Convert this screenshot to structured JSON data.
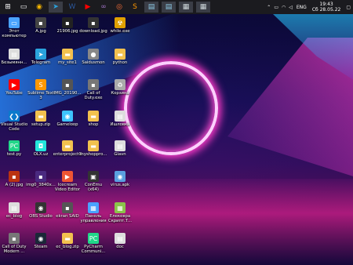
{
  "taskbar": {
    "apps": [
      {
        "name": "start-icon",
        "glyph": "⊞",
        "color": "#ffffff"
      },
      {
        "name": "task-view-icon",
        "glyph": "▭",
        "color": "#ffffff"
      },
      {
        "name": "chrome-icon",
        "glyph": "◉",
        "color": "#f4b400"
      },
      {
        "name": "telegram-icon",
        "glyph": "➤",
        "color": "#2aa3dd",
        "active": true
      },
      {
        "name": "word-icon",
        "glyph": "W",
        "color": "#2b579a"
      },
      {
        "name": "youtube-icon",
        "glyph": "▶",
        "color": "#ff0000"
      },
      {
        "name": "visual-studio-icon",
        "glyph": "∞",
        "color": "#a074c4"
      },
      {
        "name": "firefox-icon",
        "glyph": "◎",
        "color": "#ff7139"
      },
      {
        "name": "sublime-icon",
        "glyph": "S",
        "color": "#ff9800"
      },
      {
        "name": "file-explorer-icon",
        "glyph": "▤",
        "color": "#8ecae6",
        "active": true
      },
      {
        "name": "file-explorer-icon-2",
        "glyph": "▤",
        "color": "#8ecae6",
        "active": true
      },
      {
        "name": "terminal-icon",
        "glyph": "▦",
        "color": "#cfd8dc",
        "active": true
      },
      {
        "name": "terminal-icon-2",
        "glyph": "▦",
        "color": "#cfd8dc",
        "active": true
      }
    ],
    "tray": {
      "lang": "ENG",
      "time": "19:43",
      "date": "Сб 28.05.22"
    }
  },
  "icons": [
    {
      "label": "Этот компьютер",
      "glyph": "▭",
      "color": "#4aa3ff"
    },
    {
      "label": "A.jpg",
      "glyph": "▪",
      "color": "#444"
    },
    {
      "label": "21906.jpg",
      "glyph": "▪",
      "color": "#222"
    },
    {
      "label": "download.jpg",
      "glyph": "▪",
      "color": "#333"
    },
    {
      "label": "while.exe",
      "glyph": "☢",
      "color": "#e0a000"
    },
    {
      "label": "Безымянн...",
      "glyph": "▤",
      "color": "#ddd"
    },
    {
      "label": "Telegram",
      "glyph": "➤",
      "color": "#2aa3dd"
    },
    {
      "label": "my_site1",
      "glyph": "▬",
      "color": "#f2c14e"
    },
    {
      "label": "Saidusmon",
      "glyph": "●",
      "color": "#888"
    },
    {
      "label": "python",
      "glyph": "▬",
      "color": "#f2c14e"
    },
    {
      "label": "YouTube",
      "glyph": "▶",
      "color": "#ff0000"
    },
    {
      "label": "Sublime Text 3",
      "glyph": "S",
      "color": "#ff9800"
    },
    {
      "label": "IMG_20190...",
      "glyph": "▪",
      "color": "#555"
    },
    {
      "label": "Call of Duty.exe",
      "glyph": "▪",
      "color": "#777"
    },
    {
      "label": "Корзина",
      "glyph": "♻",
      "color": "#aaa"
    },
    {
      "label": "Visual Studio Code",
      "glyph": "❮❯",
      "color": "#0a7acc"
    },
    {
      "label": "setup.zip",
      "glyph": "▬",
      "color": "#f2c14e"
    },
    {
      "label": "Gameloop",
      "glyph": "◉",
      "color": "#3ec4ff"
    },
    {
      "label": "shop",
      "glyph": "▬",
      "color": "#f2c14e"
    },
    {
      "label": "Ишловка",
      "glyph": "▤",
      "color": "#ddd"
    },
    {
      "label": "test.py",
      "glyph": "PC",
      "color": "#21d789"
    },
    {
      "label": "OLX.uz",
      "glyph": "◘",
      "color": "#23e5db"
    },
    {
      "label": "enterprojectG",
      "glyph": "▬",
      "color": "#f2c14e"
    },
    {
      "label": "myshoppro...",
      "glyph": "▬",
      "color": "#f2c14e"
    },
    {
      "label": "Glavn",
      "glyph": "▤",
      "color": "#ddd"
    },
    {
      "label": "A (2).jpg",
      "glyph": "▪",
      "color": "#b31"
    },
    {
      "label": "img0_3840x...",
      "glyph": "▪",
      "color": "#4a2a80"
    },
    {
      "label": "Icecream Video Editor",
      "glyph": "▶",
      "color": "#e53"
    },
    {
      "label": "ConEmu (x64)",
      "glyph": "▣",
      "color": "#333"
    },
    {
      "label": "virus.apk",
      "glyph": "◉",
      "color": "#5aa0e0"
    },
    {
      "label": "ec_blog",
      "glyph": "▤",
      "color": "#ddd"
    },
    {
      "label": "OBS Studio",
      "glyph": "◉",
      "color": "#333"
    },
    {
      "label": "ekran SAID",
      "glyph": "▪",
      "color": "#555"
    },
    {
      "label": "Панель управления",
      "glyph": "▦",
      "color": "#4aa3ff"
    },
    {
      "label": "Елекевра Скрипт.Т...",
      "glyph": "▦",
      "color": "#8bc34a"
    },
    {
      "label": "Call of Duty Modern ...",
      "glyph": "▪",
      "color": "#777"
    },
    {
      "label": "Steam",
      "glyph": "◉",
      "color": "#1b2838"
    },
    {
      "label": "ec_blog.zip",
      "glyph": "▬",
      "color": "#f2c14e"
    },
    {
      "label": "PyCharm Communi...",
      "glyph": "PC",
      "color": "#21d789"
    },
    {
      "label": "doc",
      "glyph": "▤",
      "color": "#ddd"
    }
  ]
}
